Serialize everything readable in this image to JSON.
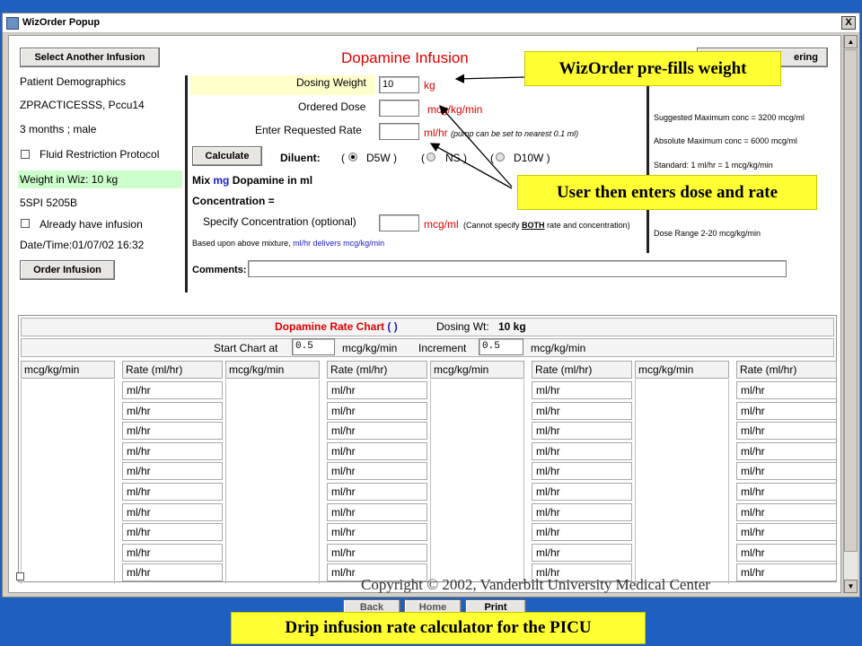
{
  "window": {
    "title": "WizOrder Popup",
    "close_label": "X"
  },
  "left_panel": {
    "select_another_label": "Select Another Infusion",
    "patient_demographics": "Patient Demographics",
    "patient_name": "ZPRACTICESSS, Pccu14",
    "age_sex": "3 months ; male",
    "fluid_restriction": "Fluid Restriction Protocol",
    "weight_in_wiz": "Weight in Wiz: 10 kg",
    "location": "5SPI 5205B",
    "already_have": "Already have infusion",
    "datetime": "Date/Time:01/07/02 16:32",
    "order_infusion_label": "Order Infusion"
  },
  "form": {
    "title": "Dopamine Infusion",
    "dosing_weight_label": "Dosing Weight",
    "dosing_weight_value": "10",
    "dosing_weight_unit": "kg",
    "ordered_dose_label": "Ordered Dose",
    "ordered_dose_unit": "mcg/kg/min",
    "rate_label": "Enter Requested Rate",
    "rate_unit": "ml/hr",
    "rate_note": "(pump can be set to nearest 0.1 ml)",
    "calculate_label": "Calculate",
    "diluent_label": "Diluent:",
    "diluent_options": [
      {
        "open": "(",
        "label": "D5W )"
      },
      {
        "open": "(",
        "label": "NS )"
      },
      {
        "open": "(",
        "label": "D10W )"
      }
    ],
    "mix_prefix": "Mix",
    "mix_mg": "mg",
    "mix_suffix": "Dopamine in ml",
    "concentration": "Concentration =",
    "specify_conc": "Specify Concentration (optional)",
    "conc_unit": "mcg/ml",
    "conc_note_pre": "(Cannot specify",
    "conc_note_both": "BOTH",
    "conc_note_post": "rate and concentration)",
    "based_upon_pre": "Based upon above mixture,",
    "based_upon_blue": "ml/hr delivers mcg/kg/min",
    "comments_label": "Comments:"
  },
  "right_panel": {
    "ordering_button_label": "ering",
    "suggested_max": "Suggested Maximum conc = 3200 mcg/ml",
    "absolute_max": "Absolute Maximum conc = 6000 mcg/ml",
    "standard": "Standard: 1 ml/hr = 1 mcg/kg/min",
    "dose_range": "Dose Range 2-20 mcg/kg/min"
  },
  "chart": {
    "title": "Dopamine Rate Chart",
    "title_paren": "( )",
    "dosing_wt_label": "Dosing Wt:",
    "dosing_wt_value": "10 kg",
    "start_chart_label": "Start Chart at",
    "start_value": "0.5",
    "start_unit": "mcg/kg/min",
    "increment_label": "Increment",
    "increment_value": "0.5",
    "increment_unit": "mcg/kg/min",
    "col_mcg": "mcg/kg/min",
    "col_rate": "Rate (ml/hr)",
    "cell_unit": "ml/hr"
  },
  "callouts": {
    "prefills": "WizOrder pre-fills weight",
    "user_enters": "User then enters dose and rate",
    "caption": "Drip infusion rate calculator for the PICU"
  },
  "footer": {
    "copyright": "Copyright © 2002, Vanderbilt University Medical Center",
    "back_label": "Back",
    "home_label": "Home",
    "print_label": "Print"
  },
  "colors": {
    "desktop": "#1f5fbf",
    "callout": "#ffff33",
    "accent_red": "#e00000",
    "accent_blue": "#1a1ad0",
    "weight_highlight": "#ccffcc",
    "dosing_row_highlight": "#ffffcc"
  }
}
